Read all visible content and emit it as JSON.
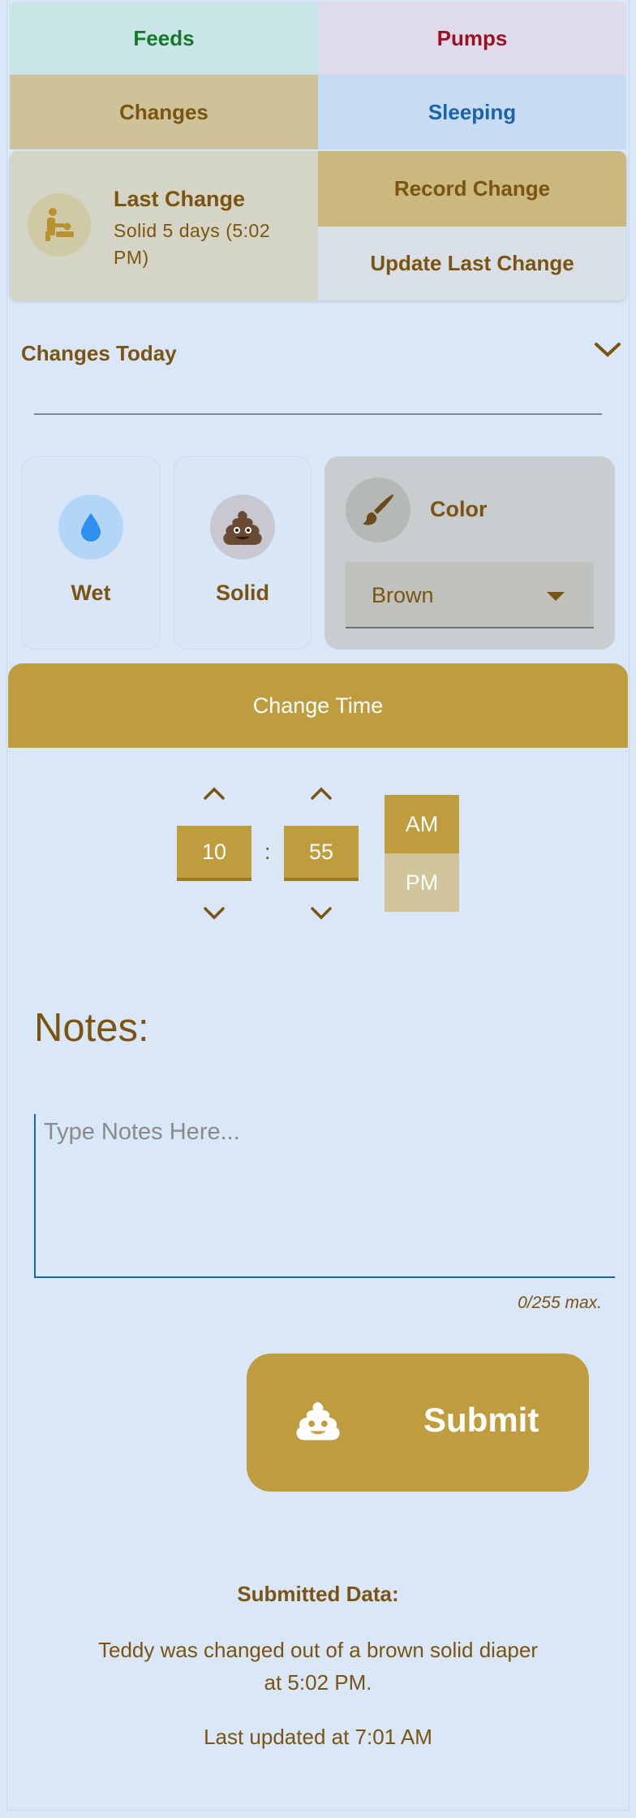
{
  "nav": {
    "feeds": "Feeds",
    "pumps": "Pumps",
    "changes": "Changes",
    "sleeping": "Sleeping"
  },
  "summary": {
    "title": "Last Change",
    "detail": "Solid  5 days (5:02 PM)",
    "record_button": "Record Change",
    "update_button": "Update Last Change"
  },
  "changes_today": {
    "title": "Changes Today"
  },
  "diaper_types": [
    {
      "label": "Wet",
      "icon": "water-drop-icon"
    },
    {
      "label": "Solid",
      "icon": "poop-icon"
    }
  ],
  "color": {
    "label": "Color",
    "selected": "Brown",
    "icon": "brush-icon"
  },
  "time": {
    "header": "Change Time",
    "hour": "10",
    "minute": "55",
    "separator": ":",
    "am": "AM",
    "pm": "PM",
    "selected_period": "AM"
  },
  "notes": {
    "title": "Notes:",
    "placeholder": "Type Notes Here...",
    "value": "",
    "counter": "0/255 max."
  },
  "submit": {
    "label": "Submit",
    "icon": "poop-icon"
  },
  "submitted": {
    "title": "Submitted Data:",
    "message": "Teddy was changed out of a brown solid diaper at 5:02 PM.",
    "updated": "Last updated at 7:01 AM"
  },
  "colors": {
    "gold": "#bf9d3e",
    "brown_text": "#7a5410",
    "background": "#d9e7f8",
    "feeds_green": "#15792b",
    "pumps_red": "#9c1023",
    "sleeping_blue": "#1d63a8"
  }
}
